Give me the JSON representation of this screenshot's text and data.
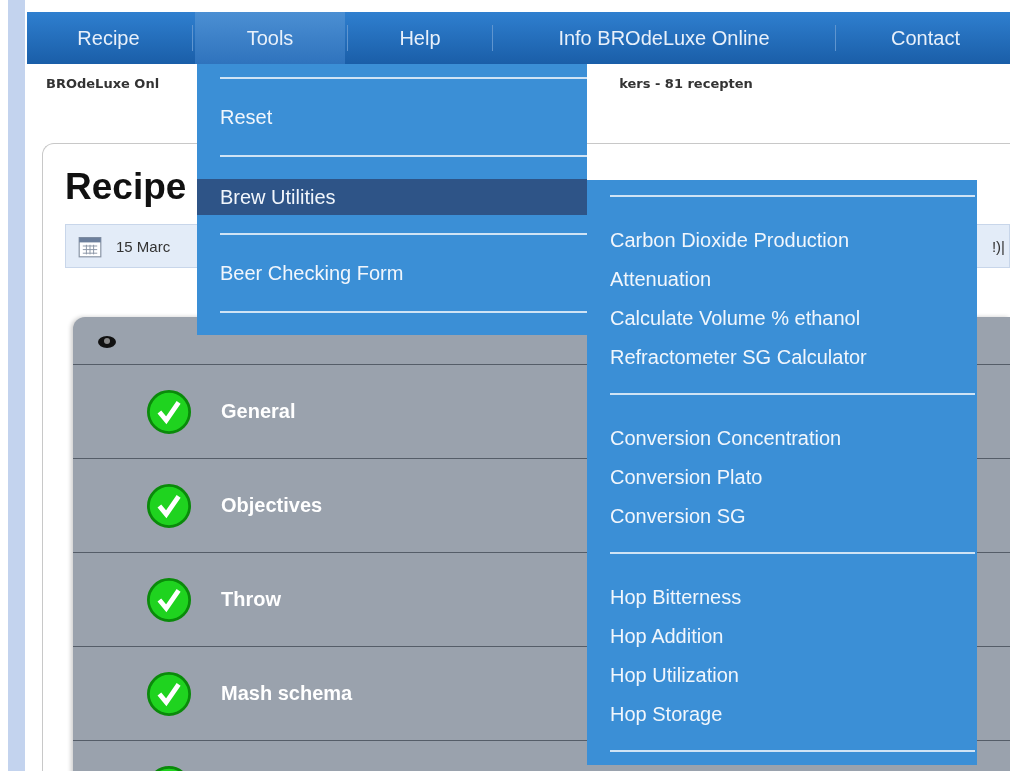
{
  "nav": [
    {
      "label": "Recipe",
      "selected": false
    },
    {
      "label": "Tools",
      "selected": true
    },
    {
      "label": "Help",
      "selected": false
    },
    {
      "label": "Info BROdeLuxe Online",
      "selected": false
    },
    {
      "label": "Contact",
      "selected": false
    }
  ],
  "header_fragments": [
    "BROdeLuxe Onl",
    "kers - 81 recepten"
  ],
  "heading": "Recipe",
  "date_bar": {
    "date": "15 Marc",
    "suffix": "!)|"
  },
  "accordion": {
    "rows": [
      {
        "label": "General",
        "done": true
      },
      {
        "label": "Objectives",
        "done": true
      },
      {
        "label": "Throw",
        "done": true
      },
      {
        "label": "Mash schema",
        "done": true
      },
      {
        "done": true
      }
    ]
  },
  "tools_menu": {
    "items": [
      {
        "kind": "separator"
      },
      {
        "kind": "item",
        "label": "Reset",
        "selected": false
      },
      {
        "kind": "separator"
      },
      {
        "kind": "item",
        "label": "Brew Utilities",
        "selected": true
      },
      {
        "kind": "separator"
      },
      {
        "kind": "item",
        "label": "Beer Checking Form",
        "selected": false
      },
      {
        "kind": "separator"
      }
    ]
  },
  "submenu": {
    "items": [
      {
        "kind": "separator"
      },
      {
        "kind": "item",
        "label": "Carbon Dioxide Production",
        "selected": false
      },
      {
        "kind": "item",
        "label": "Attenuation",
        "selected": false
      },
      {
        "kind": "item",
        "label": "Calculate Volume % ethanol",
        "selected": false
      },
      {
        "kind": "item",
        "label": "Refractometer SG Calculator",
        "selected": false
      },
      {
        "kind": "separator"
      },
      {
        "kind": "item",
        "label": "Conversion Concentration",
        "selected": false
      },
      {
        "kind": "item",
        "label": "Conversion Plato",
        "selected": false
      },
      {
        "kind": "item",
        "label": "Conversion SG",
        "selected": false
      },
      {
        "kind": "separator"
      },
      {
        "kind": "item",
        "label": "Hop Bitterness",
        "selected": false
      },
      {
        "kind": "item",
        "label": "Hop Addition",
        "selected": false
      },
      {
        "kind": "item",
        "label": "Hop Utilization",
        "selected": false
      },
      {
        "kind": "item",
        "label": "Hop Storage",
        "selected": false
      },
      {
        "kind": "separator"
      }
    ]
  }
}
